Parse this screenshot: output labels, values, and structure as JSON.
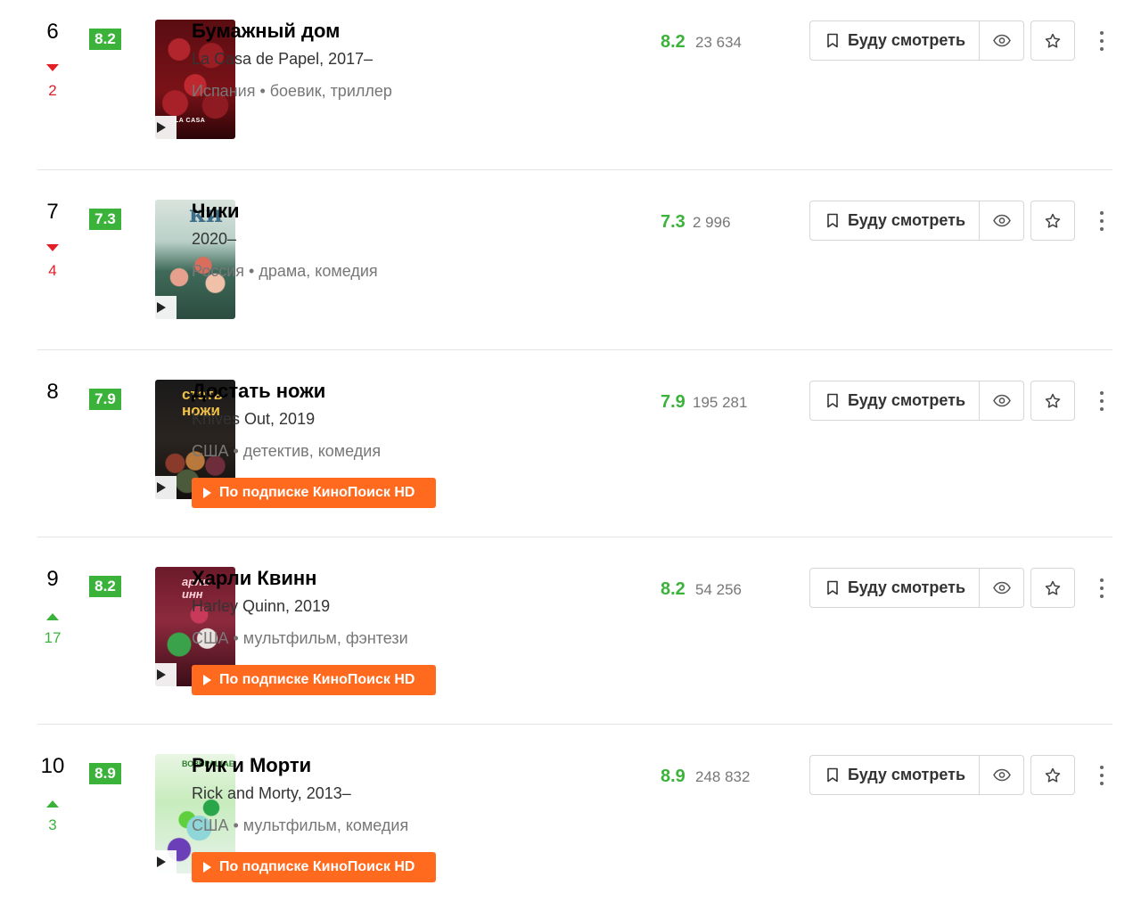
{
  "labels": {
    "watch_later": "Буду смотреть",
    "subscription": "По подписке КиноПоиск HD"
  },
  "colors": {
    "rating_green": "#3bb33b",
    "trend_down": "#e31e24",
    "trend_up": "#3bb33b",
    "subscription_orange": "#ff6a1f"
  },
  "items": [
    {
      "position": "6",
      "trend": "down",
      "trend_value": "2",
      "poster_rating": "8.2",
      "title": "Бумажный дом",
      "subtitle": "La Casa de Papel, 2017–",
      "meta": "Испания • боевик, триллер",
      "rating": "8.2",
      "votes": "23 634",
      "has_subscription": false
    },
    {
      "position": "7",
      "trend": "down",
      "trend_value": "4",
      "poster_rating": "7.3",
      "title": "Чики",
      "subtitle": "2020–",
      "meta": "Россия • драма, комедия",
      "rating": "7.3",
      "votes": "2 996",
      "has_subscription": false
    },
    {
      "position": "8",
      "trend": "none",
      "trend_value": "",
      "poster_rating": "7.9",
      "title": "Достать ножи",
      "subtitle": "Knives Out, 2019",
      "meta": "США • детектив, комедия",
      "rating": "7.9",
      "votes": "195 281",
      "has_subscription": true
    },
    {
      "position": "9",
      "trend": "up",
      "trend_value": "17",
      "poster_rating": "8.2",
      "title": "Харли Квинн",
      "subtitle": "Harley Quinn, 2019",
      "meta": "США • мультфильм, фэнтези",
      "rating": "8.2",
      "votes": "54 256",
      "has_subscription": true
    },
    {
      "position": "10",
      "trend": "up",
      "trend_value": "3",
      "poster_rating": "8.9",
      "title": "Рик и Морти",
      "subtitle": "Rick and Morty, 2013–",
      "meta": "США • мультфильм, комедия",
      "rating": "8.9",
      "votes": "248 832",
      "has_subscription": true
    }
  ]
}
